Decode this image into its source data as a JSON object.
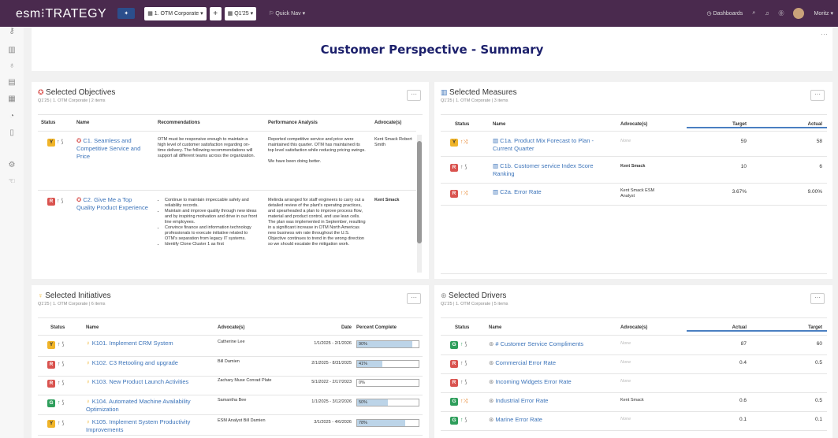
{
  "topbar": {
    "logo_text": "esm⁝TRATEGY",
    "org_select": "1. OTM Corporate ▾",
    "plus": "+",
    "period_select": "Q1'25 ▾",
    "quick_nav": "Quick Nav ▾",
    "dashboards": "Dashboards",
    "user": "Moritz ▾"
  },
  "page": {
    "title": "Customer Perspective - Summary",
    "menu": "···"
  },
  "objectives": {
    "title": "Selected Objectives",
    "subtitle": "Q1'25 | 1. OTM Corporate | 2 items",
    "menu": "···",
    "headers": {
      "status": "Status",
      "name": "Name",
      "recommendations": "Recommendations",
      "analysis": "Performance Analysis",
      "advocates": "Advocate(s)"
    },
    "rows": [
      {
        "status": "Y",
        "name": "C1. Seamless and Competitive Service and Price",
        "recommendation": "OTM must be responsive enough to maintain a high level of customer satisfaction regarding on-time delivery. The following recommendations will support all different teams across the organization.",
        "analysis": "Reported competitive service and price were maintained this quarter.  OTM has maintained its top level satisfaction while reducing pricing swings.",
        "analysis2": "We have been doing better.",
        "advocate": "Kent Smack Robert Smith"
      },
      {
        "status": "R",
        "name": "C2. Give Me a Top Quality Product Experience",
        "recommendations": [
          "Continue to maintain impeccable safety and reliability records.",
          "Maintain and improve quality through new ideas and by inspiring motivation and drive in our front line employees.",
          "Convince finance and information technology professionals to execute initiative related to OTM's separation from legacy IT systems.",
          "Identify Clone Cluster 1 as first"
        ],
        "analysis": "Melinda arranged for staff engineers to carry out a detailed review of the plant's operating practices, and spearheaded a plan to improve process flow, material and product control, and use lean cells. The plan was implemented in September, resulting in a significant increase in OTM North Americas new business win rate throughout the U.S. Objective continues to trend in the wrong direction so we should escalate the mitigation work.",
        "advocate": "Kent Smack"
      }
    ]
  },
  "measures": {
    "title": "Selected Measures",
    "subtitle": "Q1'25 | 1. OTM Corporate | 3 items",
    "menu": "···",
    "headers": {
      "status": "Status",
      "name": "Name",
      "advocates": "Advocate(s)",
      "target": "Target",
      "actual": "Actual"
    },
    "rows": [
      {
        "status": "Y",
        "name": "C1a. Product Mix Forecast to Plan - Current Quarter",
        "advocate": "None",
        "target": "59",
        "actual": "58"
      },
      {
        "status": "R",
        "name": "C1b. Customer service Index Score Ranking",
        "advocate": "Kent Smack",
        "target": "10",
        "actual": "6"
      },
      {
        "status": "R",
        "name": "C2a. Error Rate",
        "advocate": "Kent Smack ESM Analyst",
        "target": "3.67%",
        "actual": "9.00%"
      }
    ]
  },
  "initiatives": {
    "title": "Selected Initiatives",
    "subtitle": "Q1'25 | 1. OTM Corporate | 6 items",
    "menu": "···",
    "headers": {
      "status": "Status",
      "name": "Name",
      "advocates": "Advocate(s)",
      "date": "Date",
      "percent": "Percent Complete"
    },
    "rows": [
      {
        "status": "Y",
        "name": "K101. Implement CRM System",
        "advocate": "Catherine Lee",
        "date": "1/1/2025 - 2/1/2026",
        "percent_label": "90%",
        "percent": 90
      },
      {
        "status": "R",
        "name": "K102. C3 Retooling and upgrade",
        "advocate": "Bill Damien",
        "date": "2/1/2025 - 8/31/2025",
        "percent_label": "41%",
        "percent": 41
      },
      {
        "status": "R",
        "name": "K103. New Product Launch Activities",
        "advocate": "Zachary Muse Conrad Plate",
        "date": "5/1/2022 - 2/17/2023",
        "percent_label": "0%",
        "percent": 0
      },
      {
        "status": "G",
        "name": "K104. Automated Machine Availability Optimization",
        "advocate": "Samantha Bee",
        "date": "1/1/2025 - 3/12/2026",
        "percent_label": "50%",
        "percent": 50
      },
      {
        "status": "Y",
        "name": "K105. Implement System Productivity Improvements",
        "advocate": "ESM Analyst Bill Damien",
        "date": "3/1/2025 - 4/6/2026",
        "percent_label": "78%",
        "percent": 78
      }
    ]
  },
  "drivers": {
    "title": "Selected Drivers",
    "subtitle": "Q1'25 | 1. OTM Corporate | 5 items",
    "menu": "···",
    "headers": {
      "status": "Status",
      "name": "Name",
      "advocates": "Advocate(s)",
      "actual": "Actual",
      "target": "Target"
    },
    "rows": [
      {
        "status": "G",
        "name": "# Customer Service Compliments",
        "advocate": "None",
        "actual": "87",
        "target": "60"
      },
      {
        "status": "R",
        "name": "Commercial Error Rate",
        "advocate": "None",
        "actual": "0.4",
        "target": "0.5"
      },
      {
        "status": "R",
        "name": "Incoming Widgets Error Rate",
        "advocate": "None",
        "actual": "",
        "target": ""
      },
      {
        "status": "G",
        "name": "Industrial Error Rate",
        "advocate": "Kent Smack",
        "actual": "0.6",
        "target": "0.5"
      },
      {
        "status": "G",
        "name": "Marine Error Rate",
        "advocate": "None",
        "actual": "0.1",
        "target": "0.1"
      }
    ]
  },
  "colors": {
    "brand": "#4a2a4e",
    "title": "#1b1f6b",
    "link": "#3b73b9",
    "green": "#2e9e5b",
    "red": "#d9534f",
    "yellow": "#f0b429"
  }
}
